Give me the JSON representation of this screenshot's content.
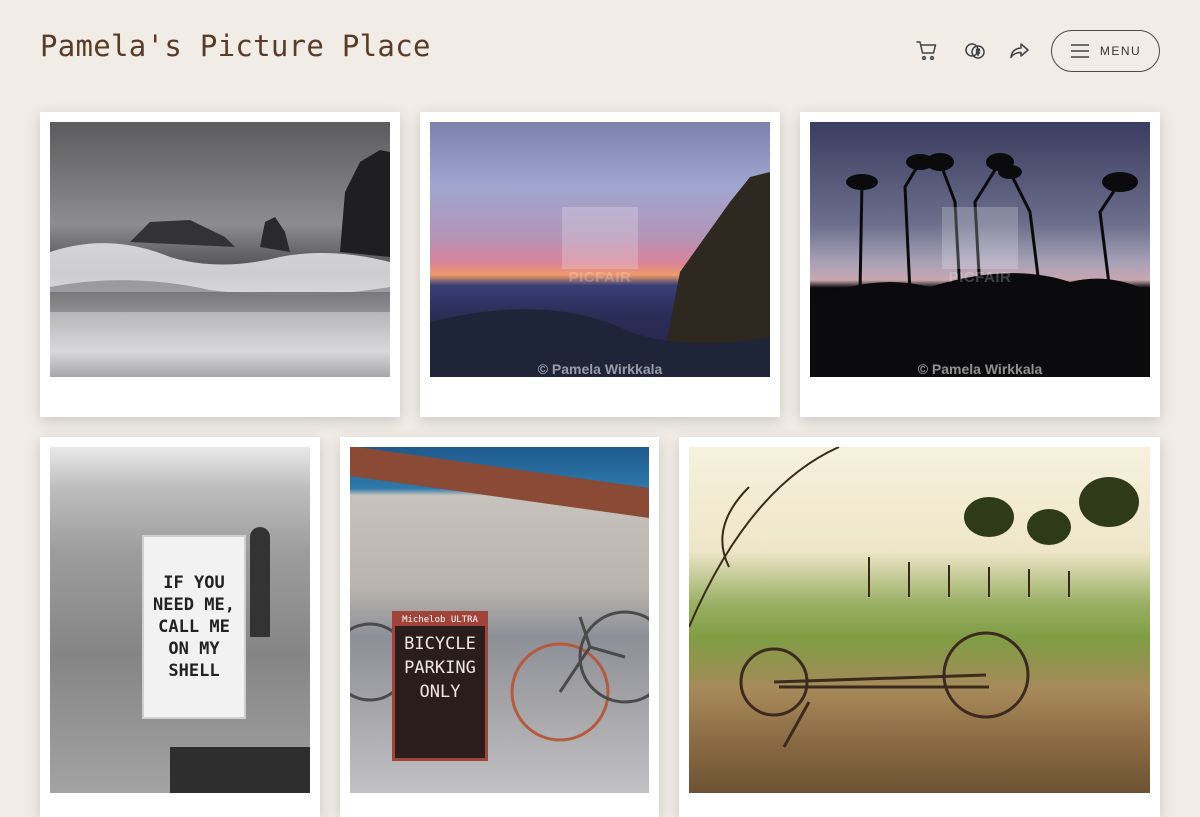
{
  "header": {
    "title": "Pamela's Picture Place",
    "menu_label": "MENU",
    "icons": [
      "cart-icon",
      "currency-icon",
      "share-icon",
      "hamburger-icon"
    ]
  },
  "watermark": {
    "brand": "PICFAIR",
    "credit": "© Pamela Wirkkala"
  },
  "photos": [
    {
      "subject": "stormy-ocean-waves"
    },
    {
      "subject": "canyon-sunset"
    },
    {
      "subject": "palm-tree-silhouettes"
    },
    {
      "subject": "shell-sign-sidewalk",
      "sign_text": [
        "IF YOU",
        "NEED ME,",
        "CALL ME",
        "ON MY",
        "SHELL"
      ]
    },
    {
      "subject": "bicycle-parking",
      "sign_brand": "Michelob ULTRA",
      "sign_text": [
        "BICYCLE",
        "PARKING",
        "ONLY"
      ]
    },
    {
      "subject": "vineyard-plow"
    }
  ],
  "colors": {
    "background": "#f1ece6",
    "title": "#5a3b27"
  }
}
